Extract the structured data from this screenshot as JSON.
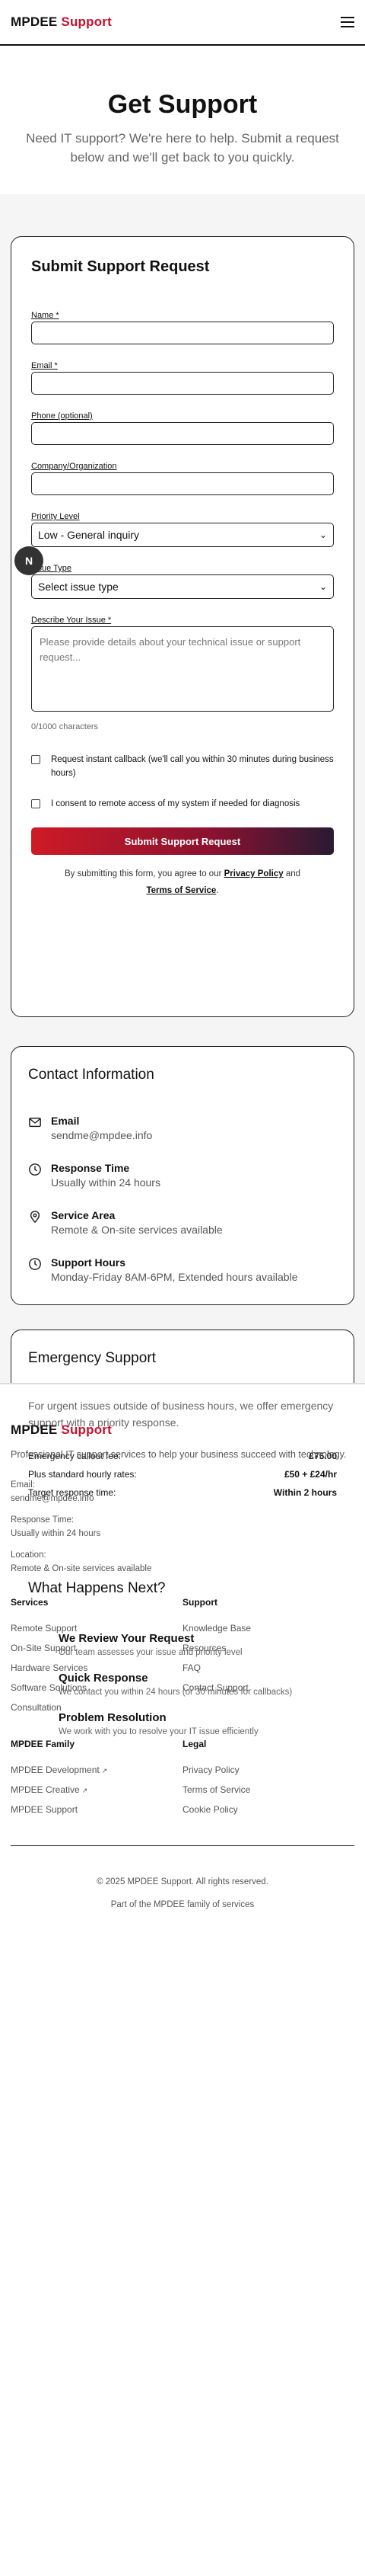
{
  "header": {
    "logo_main": "MPDEE",
    "logo_accent": "Support"
  },
  "hero": {
    "title": "Get Support",
    "subtitle": "Need IT support? We're here to help. Submit a request below and we'll get back to you quickly."
  },
  "form": {
    "title": "Submit Support Request",
    "name_label": "Name *",
    "email_label": "Email *",
    "phone_label": "Phone (optional)",
    "company_label": "Company/Organization",
    "priority_label": "Priority Level",
    "priority_value": "Low - General inquiry",
    "issue_type_label": "Issue Type",
    "issue_type_value": "Select issue type",
    "describe_label": "Describe Your Issue *",
    "describe_placeholder": "Please provide details about your technical issue or support request...",
    "char_counter": "0/1000 characters",
    "callback_label": "Request instant callback (we'll call you within 30 minutes during business hours)",
    "consent_label": "I consent to remote access of my system if needed for diagnosis",
    "submit_label": "Submit Support Request",
    "terms_prefix": "By submitting this form, you agree to our",
    "terms_privacy": "Privacy Policy",
    "terms_and": "and",
    "terms_tos": "Terms of Service",
    "avatar_letter": "N"
  },
  "contact": {
    "title": "Contact Information",
    "items": [
      {
        "title": "Email",
        "sub": "sendme@mpdee.info",
        "icon": "mail-icon"
      },
      {
        "title": "Response Time",
        "sub": "Usually within 24 hours",
        "icon": "clock-icon"
      },
      {
        "title": "Service Area",
        "sub": "Remote & On-site services available",
        "icon": "location-pin-icon"
      },
      {
        "title": "Support Hours",
        "sub": "Monday-Friday 8AM-6PM, Extended hours available",
        "icon": "clock-icon"
      }
    ]
  },
  "emergency": {
    "title": "Emergency Support",
    "desc": "For urgent issues outside of business hours, we offer emergency support with a priority response.",
    "rows": [
      {
        "label": "Emergency callout fee:",
        "value": "£75.00"
      },
      {
        "label": "Plus standard hourly rates:",
        "value": "£50 + £24/hr"
      },
      {
        "label": "Target response time:",
        "value": "Within 2 hours"
      }
    ]
  },
  "next": {
    "title": "What Happens Next?",
    "steps": [
      {
        "title": "We Review Your Request",
        "sub": "Our team assesses your issue and priority level"
      },
      {
        "title": "Quick Response",
        "sub": "We contact you within 24 hours (or 30 minutes for callbacks)"
      },
      {
        "title": "Problem Resolution",
        "sub": "We work with you to resolve your IT issue efficiently"
      }
    ]
  },
  "footer": {
    "logo_main": "MPDEE",
    "logo_accent": "Support",
    "desc": "Professional IT support services to help your business succeed with technology.",
    "email_label": "Email:",
    "email_value": "sendme@mpdee.info",
    "response_label": "Response Time:",
    "response_value": "Usually within 24 hours",
    "location_label": "Location:",
    "location_value": "Remote & On-site services available",
    "services_title": "Services",
    "services": [
      "Remote Support",
      "On-Site Support",
      "Hardware Services",
      "Software Solutions",
      "Consultation"
    ],
    "support_title": "Support",
    "support": [
      "Knowledge Base",
      "Resources",
      "FAQ",
      "Contact Support"
    ],
    "family_title": "MPDEE Family",
    "family": [
      "MPDEE Development",
      "MPDEE Creative",
      "MPDEE Support"
    ],
    "legal_title": "Legal",
    "legal": [
      "Privacy Policy",
      "Terms of Service",
      "Cookie Policy"
    ],
    "copyright": "© 2025 MPDEE Support. All rights reserved.",
    "family_note": "Part of the MPDEE family of services"
  },
  "colors": {
    "accent": "#c8102e",
    "button_gradient_start": "#cf1a27",
    "button_gradient_end": "#2a1a33"
  }
}
